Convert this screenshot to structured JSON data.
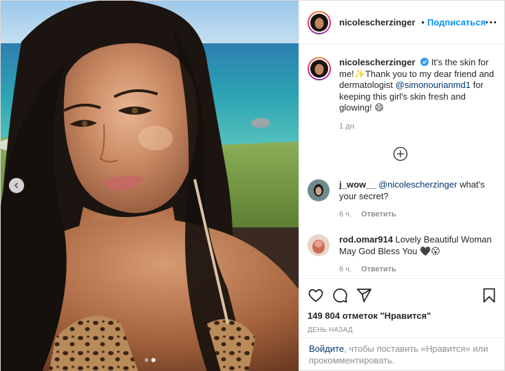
{
  "post": {
    "username": "nicolescherzinger",
    "separator": "•",
    "follow_label": "Подписаться",
    "more_icon": "more-icon",
    "verified_icon": "verified-badge-icon"
  },
  "caption": {
    "username": "nicolescherzinger",
    "text_1": " It's the skin for me!✨Thank you to my dear friend and dermatologist ",
    "mention": "@simonourianmd1",
    "text_2": " for keeping this girl's skin fresh and glowing! 😄",
    "time": "1 дн."
  },
  "load_more_icon": "plus-circle-icon",
  "comments": [
    {
      "username": "j_wow__",
      "mention": "@nicolescherzinger",
      "text": " what's your secret?",
      "time": "6 ч.",
      "reply_label": "Ответить"
    },
    {
      "username": "rod.omar914",
      "mention": "",
      "text": " Lovely Beautiful Woman May God Bless You 🖤😮",
      "time": "6 ч.",
      "reply_label": "Ответить"
    }
  ],
  "actions": {
    "likes": "149 804 отметок \"Нравится\"",
    "date": "День назад",
    "icons": [
      "heart-icon",
      "comment-icon",
      "share-icon",
      "bookmark-icon"
    ]
  },
  "login_prompt": {
    "link": "Войдите",
    "text": ", чтобы поставить «Нравится» или прокомментировать."
  },
  "carousel": {
    "total": 2,
    "active": 2
  },
  "colors": {
    "link_blue": "#0095f6",
    "mention": "#00376b",
    "secondary_text": "#8e8e8e",
    "border": "#dbdbdb"
  }
}
